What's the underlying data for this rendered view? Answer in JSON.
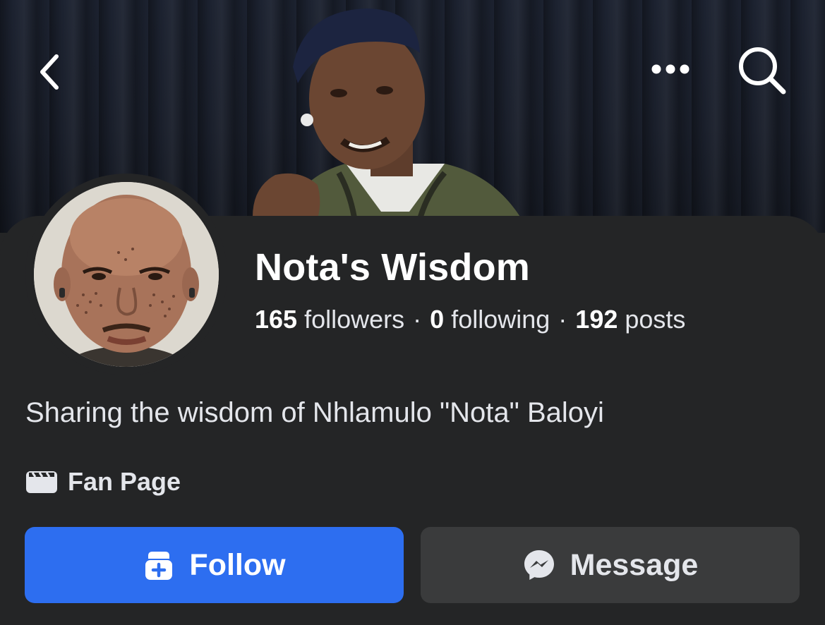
{
  "header": {
    "back_icon": "chevron-left-icon",
    "more_icon": "more-horizontal-icon",
    "search_icon": "search-icon"
  },
  "profile": {
    "name": "Nota's Wisdom",
    "followers_count": "165",
    "followers_label": "followers",
    "following_count": "0",
    "following_label": "following",
    "posts_count": "192",
    "posts_label": "posts",
    "separator": "·",
    "bio": "Sharing the wisdom of Nhlamulo \"Nota\" Baloyi",
    "category": "Fan Page",
    "category_icon": "video-clapper-icon"
  },
  "actions": {
    "follow_label": "Follow",
    "follow_icon": "follow-page-icon",
    "message_label": "Message",
    "message_icon": "messenger-icon"
  },
  "colors": {
    "background": "#242526",
    "follow_button": "#2d6ef0",
    "message_button": "#3a3b3c",
    "text_primary": "#ffffff",
    "text_secondary": "#e4e6eb"
  }
}
